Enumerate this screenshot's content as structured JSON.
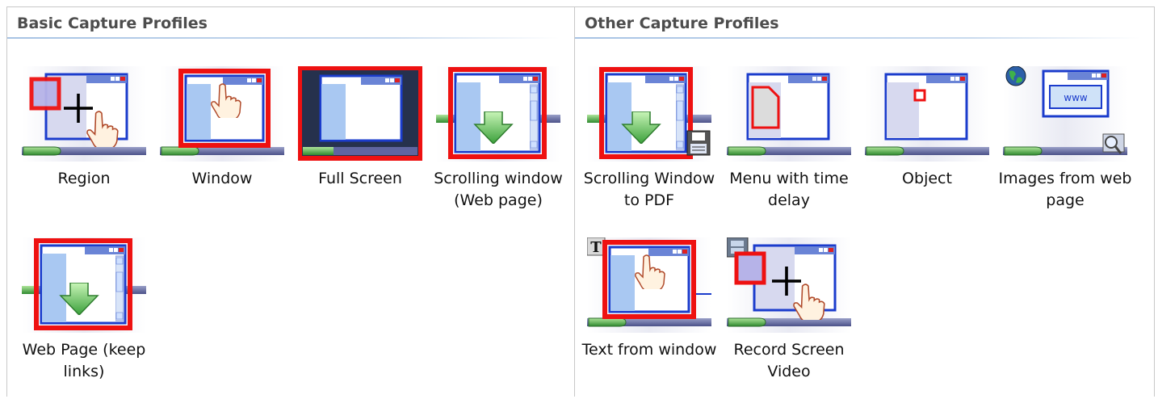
{
  "panels": {
    "basic": {
      "title": "Basic Capture Profiles",
      "items": [
        {
          "label": "Region"
        },
        {
          "label": "Window"
        },
        {
          "label": "Full Screen"
        },
        {
          "label": "Scrolling window (Web page)"
        },
        {
          "label": "Web Page (keep links)"
        }
      ]
    },
    "other": {
      "title": "Other Capture Profiles",
      "items": [
        {
          "label": "Scrolling Window to PDF"
        },
        {
          "label": "Menu with time delay"
        },
        {
          "label": "Object"
        },
        {
          "label": "Images from web page"
        },
        {
          "label": "Text from window"
        },
        {
          "label": "Record Screen Video"
        }
      ]
    }
  },
  "icon_badges": {
    "www": "www",
    "text": "T"
  },
  "colors": {
    "selection_red": "#ee1111",
    "window_blue": "#1b3ccc",
    "header_text": "#4d4d4d",
    "divider": "#a7c3e4"
  }
}
